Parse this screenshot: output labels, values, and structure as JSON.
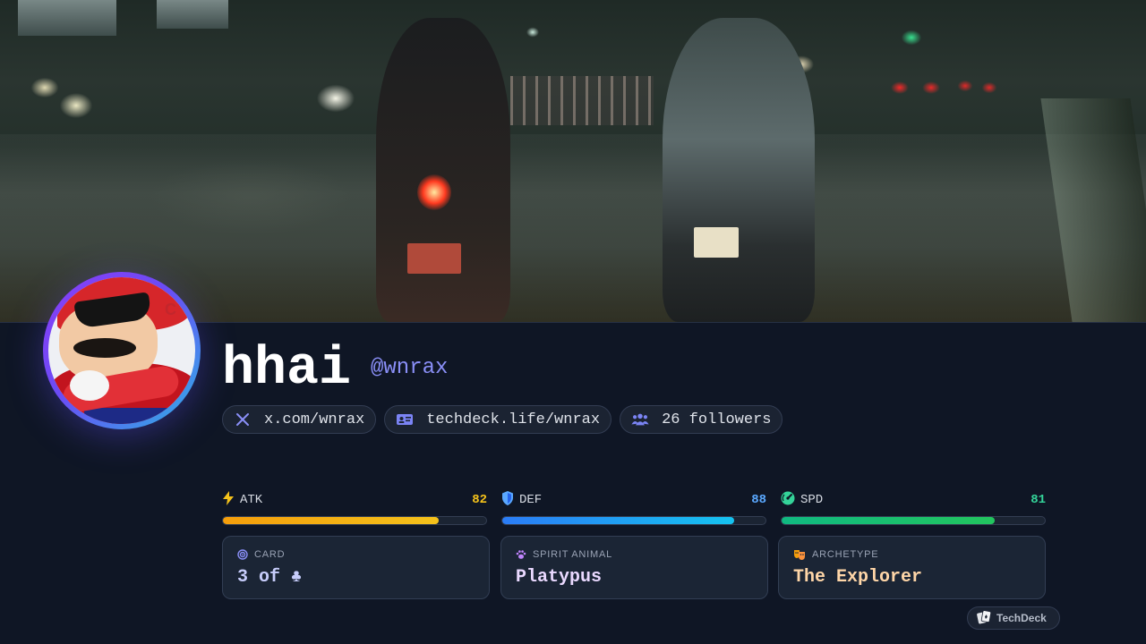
{
  "profile": {
    "display_name": "hhai",
    "handle": "@wnrax"
  },
  "links": [
    {
      "icon": "x-logo-icon",
      "label": "x.com/wnrax"
    },
    {
      "icon": "id-card-icon",
      "label": "techdeck.life/wnrax"
    },
    {
      "icon": "users-icon",
      "label": "26 followers"
    }
  ],
  "stats": {
    "atk": {
      "icon": "lightning-icon",
      "label": "ATK",
      "value": "82",
      "percent": 82,
      "color": "#f5c21b"
    },
    "def": {
      "icon": "shield-icon",
      "label": "DEF",
      "value": "88",
      "percent": 88,
      "color": "#5aa8ff"
    },
    "spd": {
      "icon": "speed-icon",
      "label": "SPD",
      "value": "81",
      "percent": 81,
      "color": "#34d399"
    }
  },
  "cards": {
    "card": {
      "icon": "target-icon",
      "caption": "CARD",
      "value": "3 of ♣",
      "color": "#c7cdfb"
    },
    "spirit": {
      "icon": "paw-icon",
      "caption": "SPIRIT ANIMAL",
      "value": "Platypus",
      "color": "#ead9ff"
    },
    "archetype": {
      "icon": "theater-masks-icon",
      "caption": "ARCHETYPE",
      "value": "The Explorer",
      "color": "#ffd6a8"
    }
  },
  "footer": {
    "brand": "TechDeck",
    "icon": "cards-icon"
  },
  "colors": {
    "background": "#0f1625",
    "accent": "#8a8ff7",
    "avatar_ring_start": "#8b3cf7",
    "avatar_ring_end": "#2db3e6"
  }
}
